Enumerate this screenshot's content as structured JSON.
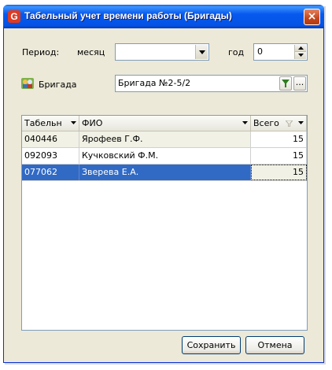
{
  "window": {
    "title": "Табельный учет времени работы (Бригады)",
    "app_icon_letter": "G",
    "close_symbol": "×"
  },
  "period": {
    "label": "Период:",
    "month_label": "месяц",
    "month_value": "",
    "year_label": "год",
    "year_value": "0"
  },
  "brigade": {
    "label": "Бригада",
    "value": "Бригада №2-5/2",
    "browse_label": "..."
  },
  "grid": {
    "columns": [
      "Табельн",
      "ФИО",
      "Всего"
    ],
    "rows": [
      {
        "tab": "040446",
        "name": "Ярофеев Г.Ф.",
        "total": "15"
      },
      {
        "tab": "092093",
        "name": "Кучковский Ф.М.",
        "total": "15"
      },
      {
        "tab": "077062",
        "name": "Зверева Е.А.",
        "total": "15"
      }
    ],
    "selected_row": 3
  },
  "buttons": {
    "save": "Сохранить",
    "cancel": "Отмена"
  },
  "colors": {
    "title_bar": "#0758ee",
    "selection": "#316ac5",
    "window_bg": "#ece9d8",
    "row_tint": "#f1f1e5"
  }
}
